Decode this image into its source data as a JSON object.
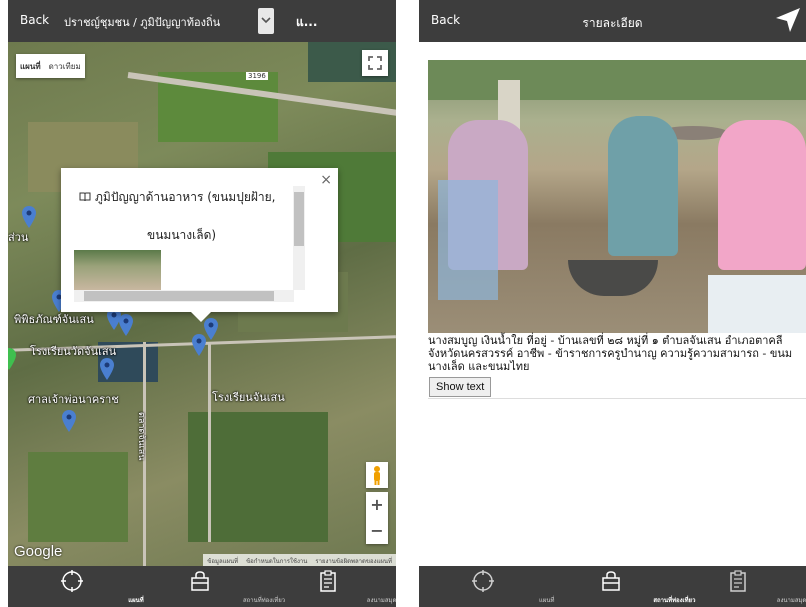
{
  "left": {
    "header": {
      "back_label": "Back",
      "title": "ปราชญ์ชุมชน / ภูมิปัญญาท้องถิ่น",
      "more_label": "แ..."
    },
    "map": {
      "maptype_options": [
        "แผนที่",
        "ดาวเทียม"
      ],
      "road_shield": "3196",
      "labels": {
        "school1": "โรงเรียนวัดจันเสน",
        "museum": "พิพิธภัณฑ์จันเสน",
        "shrine": "ศาลเจ้าพ่อนาคราช",
        "school2": "โรงเรียนจันเสน",
        "partial": "ส่วน",
        "vertical_road": "ตลาดจันเสน"
      },
      "popup": {
        "text_line1": "ภูมิปัญญาด้านอาหาร (ขนมปุยฝ้าย,",
        "text_line2": "ขนมนางเล็ด)",
        "close_symbol": "×"
      },
      "zoom_in": "+",
      "zoom_out": "−",
      "google_label": "Google",
      "attribution": [
        "ข้อมูลแผนที่",
        "ข้อกำหนดในการใช้งาน",
        "รายงานข้อผิดพลาดของแผนที่"
      ],
      "pin_color": "#4a7fd0",
      "pin_green": "#3fbf4f"
    },
    "tabs": [
      {
        "icon": "crosshair-icon",
        "label": "แผนที่",
        "active": true
      },
      {
        "icon": "store-icon",
        "label": "สถานที่ท่องเที่ยว",
        "active": false
      },
      {
        "icon": "clipboard-icon",
        "label": "ลงนามสมุดเยี่ยมชม",
        "active": false
      }
    ]
  },
  "right": {
    "header": {
      "back_label": "Back",
      "title": "รายละเอียด",
      "nav_icon": "navigation-arrow-icon"
    },
    "description": "นางสมบูญ เงินน้ำใย ที่อยู่ - บ้านเลขที่ ๒๘ หมู่ที่ ๑ ตำบลจันเสน อำเภอตาคลี จังหวัดนครสวรรค์ อาชีพ - ข้าราชการครูบำนาญ ความรู้ความสามารถ - ขนมนางเล็ด และขนมไทย",
    "show_text_label": "Show text",
    "tabs": [
      {
        "icon": "crosshair-icon",
        "label": "แผนที่",
        "active": false
      },
      {
        "icon": "store-icon",
        "label": "สถานที่ท่องเที่ยว",
        "active": true
      },
      {
        "icon": "clipboard-icon",
        "label": "ลงนามสมุดเยี่ยมชม",
        "active": false
      }
    ]
  },
  "colors": {
    "bar": "#3d3d3d",
    "pin": "#4a7fd0"
  }
}
